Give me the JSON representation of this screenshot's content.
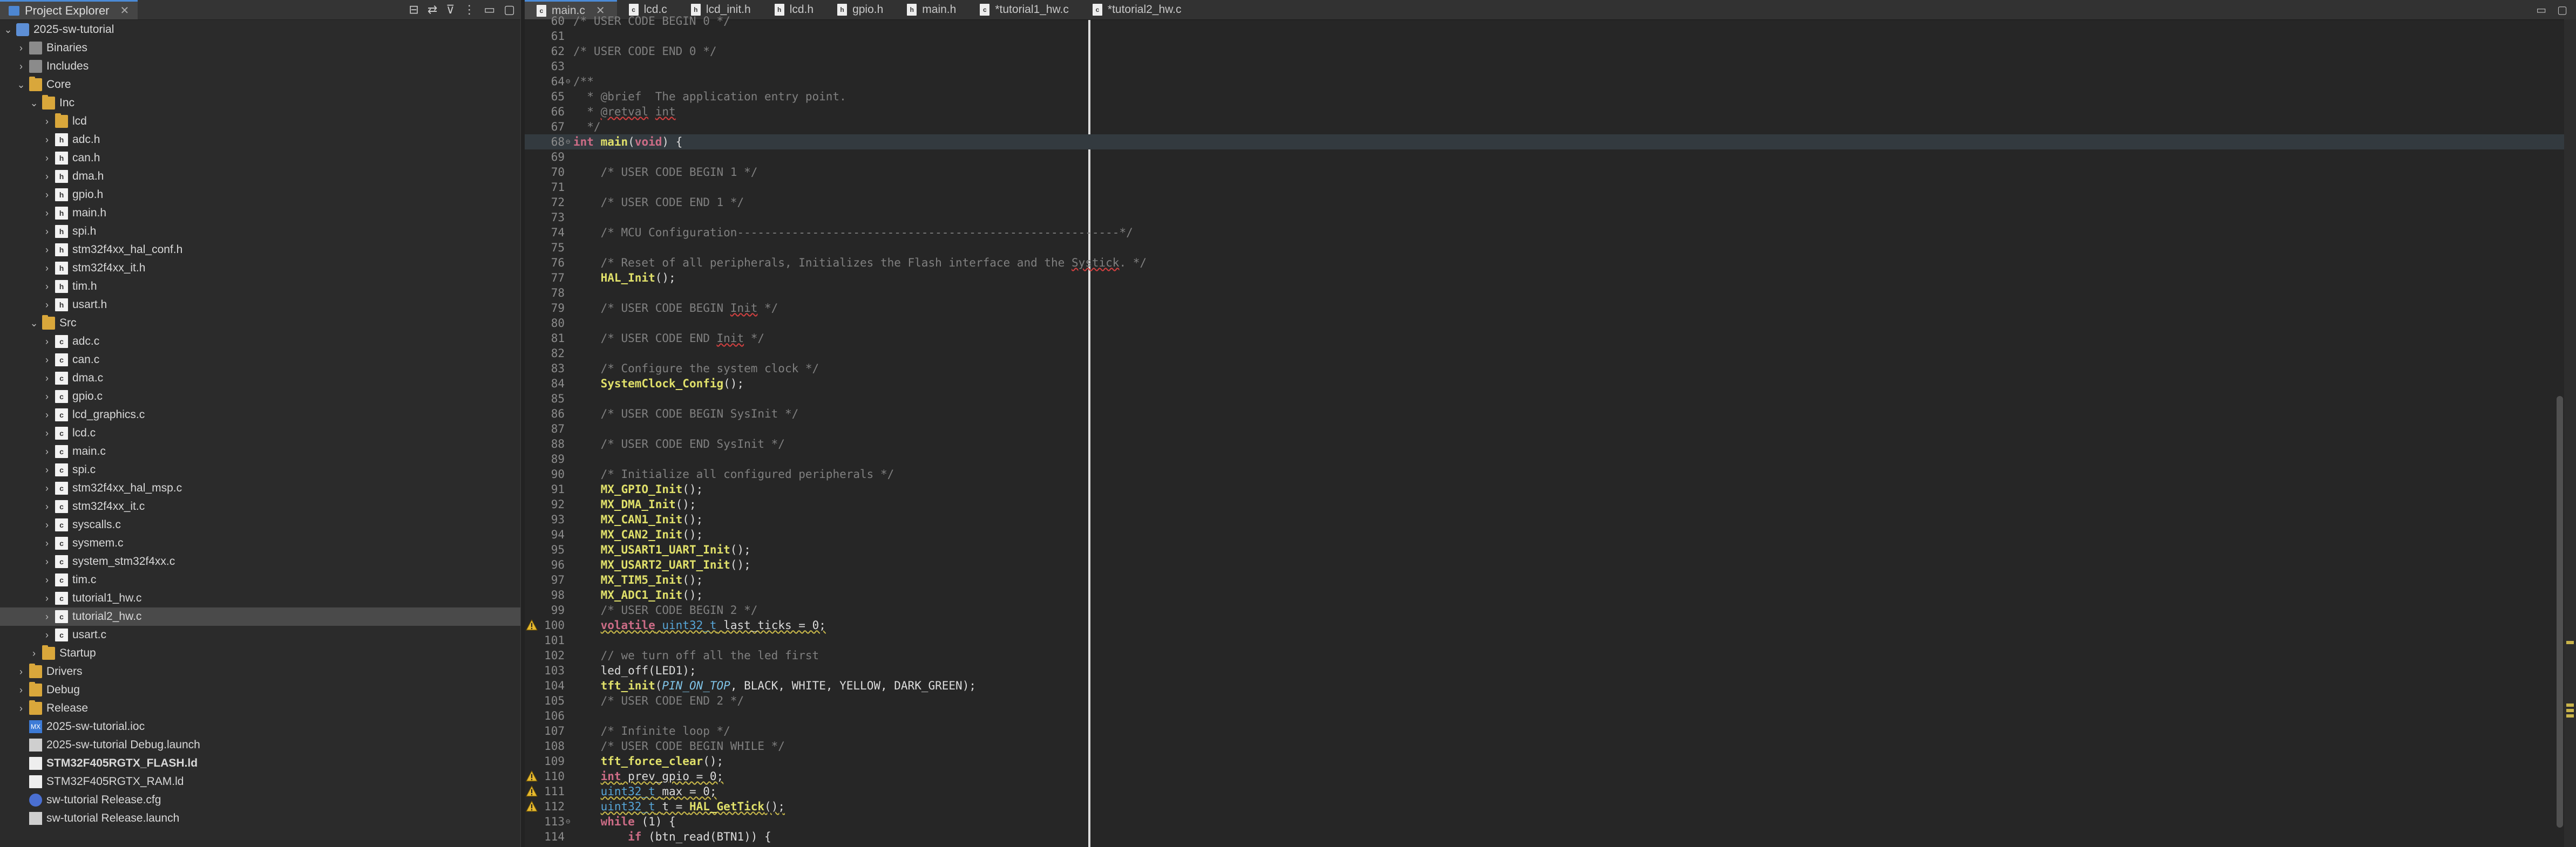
{
  "explorer": {
    "title": "Project Explorer",
    "items": [
      {
        "label": "2025-sw-tutorial",
        "indent": 0,
        "twisty": "⌄",
        "icon": "project",
        "selected": false,
        "bold": false
      },
      {
        "label": "Binaries",
        "indent": 1,
        "twisty": "›",
        "icon": "lib"
      },
      {
        "label": "Includes",
        "indent": 1,
        "twisty": "›",
        "icon": "lib"
      },
      {
        "label": "Core",
        "indent": 1,
        "twisty": "⌄",
        "icon": "folder"
      },
      {
        "label": "Inc",
        "indent": 2,
        "twisty": "⌄",
        "icon": "folder"
      },
      {
        "label": "lcd",
        "indent": 3,
        "twisty": "›",
        "icon": "folder"
      },
      {
        "label": "adc.h",
        "indent": 3,
        "twisty": "›",
        "icon": "h"
      },
      {
        "label": "can.h",
        "indent": 3,
        "twisty": "›",
        "icon": "h"
      },
      {
        "label": "dma.h",
        "indent": 3,
        "twisty": "›",
        "icon": "h"
      },
      {
        "label": "gpio.h",
        "indent": 3,
        "twisty": "›",
        "icon": "h"
      },
      {
        "label": "main.h",
        "indent": 3,
        "twisty": "›",
        "icon": "h"
      },
      {
        "label": "spi.h",
        "indent": 3,
        "twisty": "›",
        "icon": "h"
      },
      {
        "label": "stm32f4xx_hal_conf.h",
        "indent": 3,
        "twisty": "›",
        "icon": "h"
      },
      {
        "label": "stm32f4xx_it.h",
        "indent": 3,
        "twisty": "›",
        "icon": "h"
      },
      {
        "label": "tim.h",
        "indent": 3,
        "twisty": "›",
        "icon": "h"
      },
      {
        "label": "usart.h",
        "indent": 3,
        "twisty": "›",
        "icon": "h"
      },
      {
        "label": "Src",
        "indent": 2,
        "twisty": "⌄",
        "icon": "folder"
      },
      {
        "label": "adc.c",
        "indent": 3,
        "twisty": "›",
        "icon": "c"
      },
      {
        "label": "can.c",
        "indent": 3,
        "twisty": "›",
        "icon": "c"
      },
      {
        "label": "dma.c",
        "indent": 3,
        "twisty": "›",
        "icon": "c"
      },
      {
        "label": "gpio.c",
        "indent": 3,
        "twisty": "›",
        "icon": "c"
      },
      {
        "label": "lcd_graphics.c",
        "indent": 3,
        "twisty": "›",
        "icon": "c"
      },
      {
        "label": "lcd.c",
        "indent": 3,
        "twisty": "›",
        "icon": "c"
      },
      {
        "label": "main.c",
        "indent": 3,
        "twisty": "›",
        "icon": "c"
      },
      {
        "label": "spi.c",
        "indent": 3,
        "twisty": "›",
        "icon": "c"
      },
      {
        "label": "stm32f4xx_hal_msp.c",
        "indent": 3,
        "twisty": "›",
        "icon": "c"
      },
      {
        "label": "stm32f4xx_it.c",
        "indent": 3,
        "twisty": "›",
        "icon": "c"
      },
      {
        "label": "syscalls.c",
        "indent": 3,
        "twisty": "›",
        "icon": "c"
      },
      {
        "label": "sysmem.c",
        "indent": 3,
        "twisty": "›",
        "icon": "c"
      },
      {
        "label": "system_stm32f4xx.c",
        "indent": 3,
        "twisty": "›",
        "icon": "c"
      },
      {
        "label": "tim.c",
        "indent": 3,
        "twisty": "›",
        "icon": "c"
      },
      {
        "label": "tutorial1_hw.c",
        "indent": 3,
        "twisty": "›",
        "icon": "c"
      },
      {
        "label": "tutorial2_hw.c",
        "indent": 3,
        "twisty": "›",
        "icon": "c",
        "selected": true
      },
      {
        "label": "usart.c",
        "indent": 3,
        "twisty": "›",
        "icon": "c"
      },
      {
        "label": "Startup",
        "indent": 2,
        "twisty": "›",
        "icon": "folder"
      },
      {
        "label": "Drivers",
        "indent": 1,
        "twisty": "›",
        "icon": "folder"
      },
      {
        "label": "Debug",
        "indent": 1,
        "twisty": "›",
        "icon": "folder"
      },
      {
        "label": "Release",
        "indent": 1,
        "twisty": "›",
        "icon": "folder"
      },
      {
        "label": "2025-sw-tutorial.ioc",
        "indent": 1,
        "twisty": "",
        "icon": "ioc"
      },
      {
        "label": "2025-sw-tutorial Debug.launch",
        "indent": 1,
        "twisty": "",
        "icon": "launch"
      },
      {
        "label": "STM32F405RGTX_FLASH.ld",
        "indent": 1,
        "twisty": "",
        "icon": "ld",
        "bold": true
      },
      {
        "label": "STM32F405RGTX_RAM.ld",
        "indent": 1,
        "twisty": "",
        "icon": "ld"
      },
      {
        "label": "sw-tutorial Release.cfg",
        "indent": 1,
        "twisty": "",
        "icon": "cfg"
      },
      {
        "label": "sw-tutorial Release.launch",
        "indent": 1,
        "twisty": "",
        "icon": "launch"
      }
    ]
  },
  "editor_tabs": [
    {
      "label": "main.c",
      "active": true
    },
    {
      "label": "lcd.c"
    },
    {
      "label": "lcd_init.h"
    },
    {
      "label": "lcd.h"
    },
    {
      "label": "gpio.h"
    },
    {
      "label": "main.h"
    },
    {
      "label": "*tutorial1_hw.c"
    },
    {
      "label": "*tutorial2_hw.c"
    }
  ],
  "code": [
    {
      "n": "60",
      "html": "<span class='cm'>/* USER CODE BEGIN 0 */</span>"
    },
    {
      "n": "61",
      "html": ""
    },
    {
      "n": "62",
      "html": "<span class='cm'>/* USER CODE END 0 */</span>"
    },
    {
      "n": "63",
      "html": ""
    },
    {
      "n": "64",
      "fold": "⊖",
      "html": "<span class='cm'>/**</span>"
    },
    {
      "n": "65",
      "html": "<span class='cm'>  * @brief  The application entry point.</span>"
    },
    {
      "n": "66",
      "html": "<span class='cm'>  * <span class='sq-r'>@retval</span> <span class='sq-r'>int</span></span>"
    },
    {
      "n": "67",
      "html": "<span class='cm'>  */</span>"
    },
    {
      "n": "68",
      "fold": "⊖",
      "current": true,
      "html": "<span class='kw'>int</span> <span class='fn'>main</span><span class='pl'>(</span><span class='kw'>void</span><span class='pl'>) {</span>"
    },
    {
      "n": "69",
      "html": ""
    },
    {
      "n": "70",
      "html": "    <span class='cm'>/* USER CODE BEGIN 1 */</span>"
    },
    {
      "n": "71",
      "html": ""
    },
    {
      "n": "72",
      "html": "    <span class='cm'>/* USER CODE END 1 */</span>"
    },
    {
      "n": "73",
      "html": ""
    },
    {
      "n": "74",
      "html": "    <span class='cm'>/* MCU Configuration--------------------------------------------------------*/</span>"
    },
    {
      "n": "75",
      "html": ""
    },
    {
      "n": "76",
      "html": "    <span class='cm'>/* Reset of all peripherals, Initializes the Flash interface and the <span class='sq-r'>Systick</span>. */</span>"
    },
    {
      "n": "77",
      "html": "    <span class='fn'>HAL_Init</span><span class='pl'>();</span>"
    },
    {
      "n": "78",
      "html": ""
    },
    {
      "n": "79",
      "html": "    <span class='cm'>/* USER CODE BEGIN <span class='sq-r'>Init</span> */</span>"
    },
    {
      "n": "80",
      "html": ""
    },
    {
      "n": "81",
      "html": "    <span class='cm'>/* USER CODE END <span class='sq-r'>Init</span> */</span>"
    },
    {
      "n": "82",
      "html": ""
    },
    {
      "n": "83",
      "html": "    <span class='cm'>/* Configure the system clock */</span>"
    },
    {
      "n": "84",
      "html": "    <span class='fn'>SystemClock_Config</span><span class='pl'>();</span>"
    },
    {
      "n": "85",
      "html": ""
    },
    {
      "n": "86",
      "html": "    <span class='cm'>/* USER CODE BEGIN SysInit */</span>"
    },
    {
      "n": "87",
      "html": ""
    },
    {
      "n": "88",
      "html": "    <span class='cm'>/* USER CODE END SysInit */</span>"
    },
    {
      "n": "89",
      "html": ""
    },
    {
      "n": "90",
      "html": "    <span class='cm'>/* Initialize all configured peripherals */</span>"
    },
    {
      "n": "91",
      "html": "    <span class='fn'>MX_GPIO_Init</span><span class='pl'>();</span>"
    },
    {
      "n": "92",
      "html": "    <span class='fn'>MX_DMA_Init</span><span class='pl'>();</span>"
    },
    {
      "n": "93",
      "html": "    <span class='fn'>MX_CAN1_Init</span><span class='pl'>();</span>"
    },
    {
      "n": "94",
      "html": "    <span class='fn'>MX_CAN2_Init</span><span class='pl'>();</span>"
    },
    {
      "n": "95",
      "html": "    <span class='fn'>MX_USART1_UART_Init</span><span class='pl'>();</span>"
    },
    {
      "n": "96",
      "html": "    <span class='fn'>MX_USART2_UART_Init</span><span class='pl'>();</span>"
    },
    {
      "n": "97",
      "html": "    <span class='fn'>MX_TIM5_Init</span><span class='pl'>();</span>"
    },
    {
      "n": "98",
      "html": "    <span class='fn'>MX_ADC1_Init</span><span class='pl'>();</span>"
    },
    {
      "n": "99",
      "html": "    <span class='cm'>/* USER CODE BEGIN 2 */</span>"
    },
    {
      "n": "100",
      "warn": true,
      "html": "    <span class='sq'><span class='kw'>volatile</span> <span class='ty'>uint32_t</span> <span class='pl'>last_ticks = 0;</span></span>"
    },
    {
      "n": "101",
      "html": ""
    },
    {
      "n": "102",
      "html": "    <span class='cm'>// we turn off all the led first</span>"
    },
    {
      "n": "103",
      "html": "    <span class='pl'>led_off(LED1);</span>"
    },
    {
      "n": "104",
      "html": "    <span class='fn'>tft_init</span><span class='pl'>(</span><span class='it'>PIN_ON_TOP</span><span class='pl'>, BLACK, WHITE, YELLOW, DARK_GREEN);</span>"
    },
    {
      "n": "105",
      "html": "    <span class='cm'>/* USER CODE END 2 */</span>"
    },
    {
      "n": "106",
      "html": ""
    },
    {
      "n": "107",
      "html": "    <span class='cm'>/* Infinite loop */</span>"
    },
    {
      "n": "108",
      "html": "    <span class='cm'>/* USER CODE BEGIN WHILE */</span>"
    },
    {
      "n": "109",
      "html": "    <span class='fn'>tft_force_clear</span><span class='pl'>();</span>"
    },
    {
      "n": "110",
      "warn": true,
      "html": "    <span class='sq'><span class='kw'>int</span> <span class='pl'>prev_gpio = 0;</span></span>"
    },
    {
      "n": "111",
      "warn": true,
      "html": "    <span class='sq'><span class='ty'>uint32_t</span> <span class='pl'>max = 0;</span></span>"
    },
    {
      "n": "112",
      "warn": true,
      "html": "    <span class='sq'><span class='ty'>uint32_t</span> <span class='pl'>t = </span><span class='fn'>HAL_GetTick</span><span class='pl'>();</span></span>"
    },
    {
      "n": "113",
      "fold": "⊖",
      "html": "    <span class='kw'>while</span> <span class='pl'>(1) {</span>"
    },
    {
      "n": "114",
      "html": "        <span class='kw'>if</span> <span class='pl'>(btn_read(BTN1)) {</span>"
    }
  ]
}
